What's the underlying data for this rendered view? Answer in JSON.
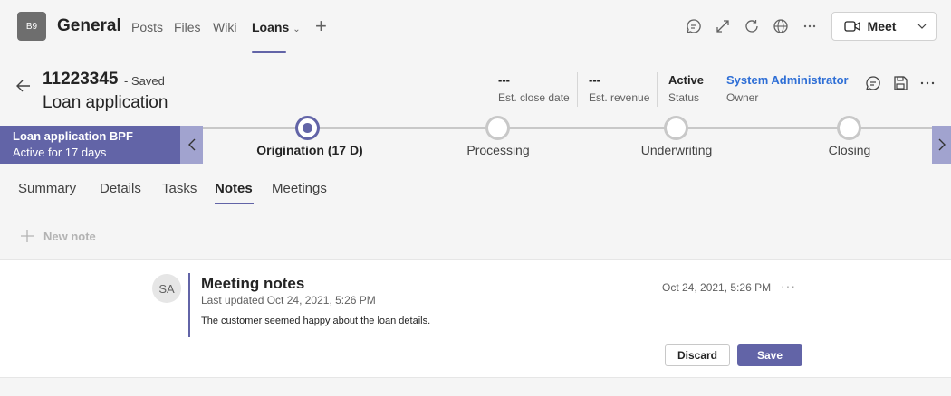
{
  "app": {
    "team_initials": "B9",
    "channel_name": "General",
    "tabs": [
      {
        "label": "Posts"
      },
      {
        "label": "Files"
      },
      {
        "label": "Wiki"
      },
      {
        "label": "Loans"
      }
    ],
    "meet_label": "Meet",
    "accent_color": "#6264a7"
  },
  "record": {
    "id": "11223345",
    "saved_status": "- Saved",
    "title": "Loan application",
    "fields": [
      {
        "value": "---",
        "label": "Est. close date"
      },
      {
        "value": "---",
        "label": "Est. revenue"
      },
      {
        "value": "Active",
        "label": "Status"
      },
      {
        "value": "System Administrator",
        "label": "Owner"
      }
    ]
  },
  "bpf": {
    "name": "Loan application BPF",
    "subtitle": "Active for 17 days",
    "stages": [
      {
        "label": "Origination  (17 D)",
        "active": true
      },
      {
        "label": "Processing",
        "active": false
      },
      {
        "label": "Underwriting",
        "active": false
      },
      {
        "label": "Closing",
        "active": false
      }
    ]
  },
  "form_tabs": [
    {
      "label": "Summary"
    },
    {
      "label": "Details"
    },
    {
      "label": "Tasks"
    },
    {
      "label": "Notes"
    },
    {
      "label": "Meetings"
    }
  ],
  "notes": {
    "new_note_label": "New note",
    "items": [
      {
        "avatar": "SA",
        "title": "Meeting notes",
        "updated": "Last updated Oct 24, 2021, 5:26 PM",
        "body": "The customer seemed happy about the loan details.",
        "date": "Oct 24, 2021, 5:26 PM",
        "more": "···",
        "discard_label": "Discard",
        "save_label": "Save"
      }
    ]
  }
}
